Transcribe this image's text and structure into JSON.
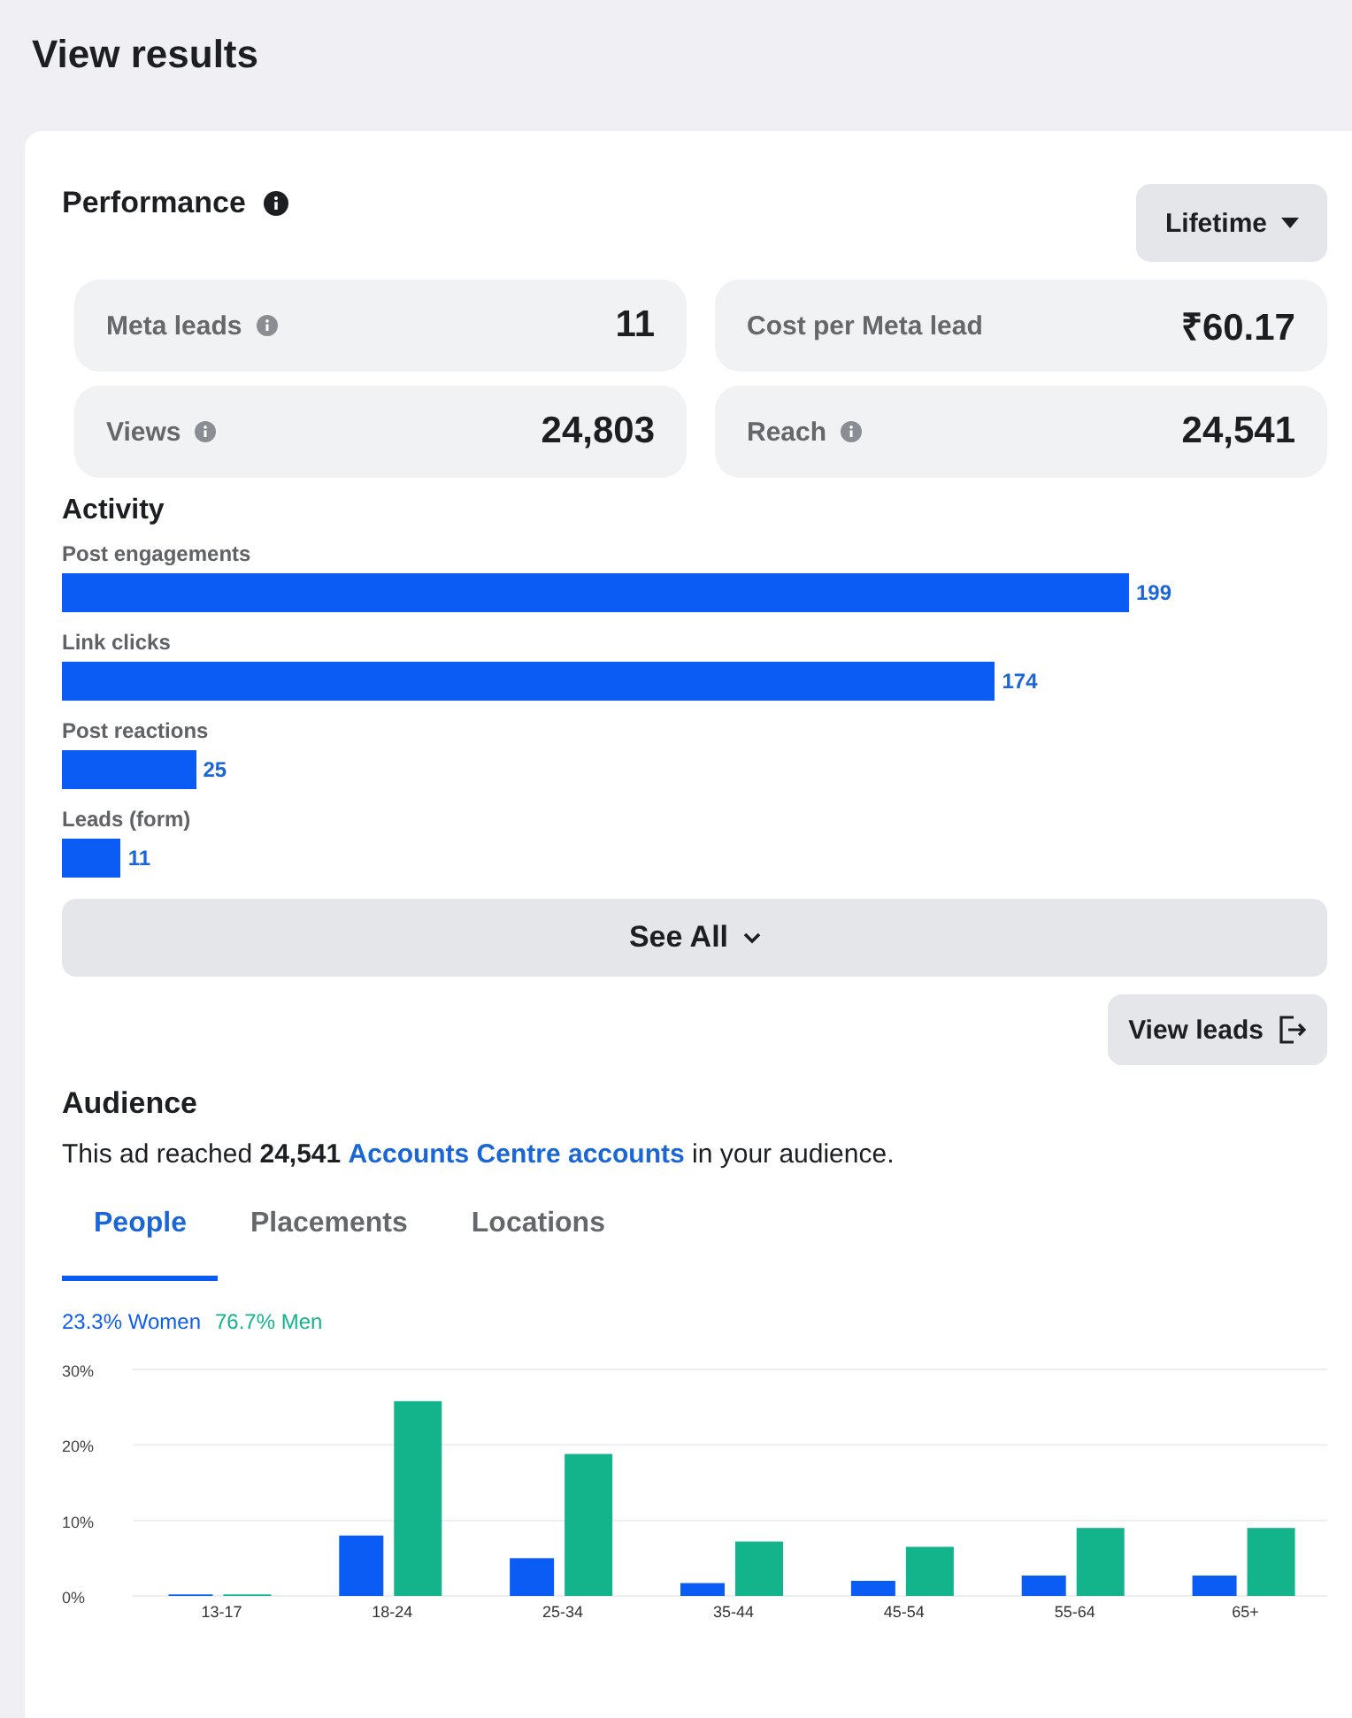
{
  "page_title": "View results",
  "performance": {
    "title": "Performance",
    "period": "Lifetime",
    "stats": [
      {
        "label": "Meta leads",
        "info": true,
        "value": "11"
      },
      {
        "label": "Cost per Meta lead",
        "info": false,
        "value": "₹60.17"
      },
      {
        "label": "Views",
        "info": true,
        "value": "24,803"
      },
      {
        "label": "Reach",
        "info": true,
        "value": "24,541"
      }
    ]
  },
  "activity": {
    "title": "Activity",
    "items": [
      {
        "label": "Post engagements",
        "value": "199"
      },
      {
        "label": "Link clicks",
        "value": "174"
      },
      {
        "label": "Post reactions",
        "value": "25"
      },
      {
        "label": "Leads (form)",
        "value": "11"
      }
    ],
    "see_all": "See All",
    "view_leads": "View leads"
  },
  "audience": {
    "title": "Audience",
    "summary": "This ad reached **24,541** ",
    "link": "Accounts Centre accounts",
    "summary_end": " in your audience.",
    "tabs": [
      {
        "label": "People",
        "selected": true
      },
      {
        "label": "Placements",
        "selected": false
      },
      {
        "label": "Locations",
        "selected": false
      }
    ],
    "legend": [
      {
        "share": "23.3%"
      },
      {
        "share": "76.7%"
      }
    ],
    "chart_data": {
      "type": "bar",
      "categories": [
        "13-17",
        "18-24",
        "25-34",
        "35-44",
        "45-54",
        "55-64",
        "65+"
      ],
      "series": [
        {
          "name": "Women",
          "color": "#0a5cf5",
          "values": [
            0.2,
            8,
            5,
            1.7,
            2,
            2.7,
            2.7
          ]
        },
        {
          "name": "Men",
          "color": "#13b38c",
          "values": [
            0.2,
            25.8,
            18.8,
            7.2,
            6.5,
            9,
            9
          ]
        }
      ],
      "ylim": [
        0,
        30
      ],
      "yticks": [
        {
          "value": 0,
          "label": "0%"
        },
        {
          "value": 10,
          "label": "10%"
        },
        {
          "value": 20,
          "label": "20%"
        },
        {
          "value": 30,
          "label": "30%"
        }
      ]
    }
  }
}
